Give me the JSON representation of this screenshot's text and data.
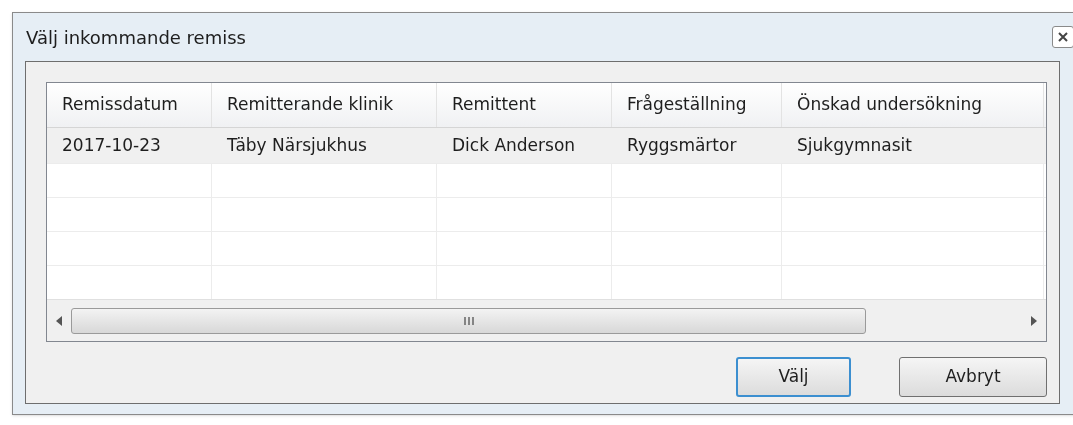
{
  "window": {
    "title": "Välj inkommande remiss"
  },
  "table": {
    "columns": [
      "Remissdatum",
      "Remitterande klinik",
      "Remittent",
      "Frågeställning",
      "Önskad undersökning"
    ],
    "rows": [
      {
        "cells": [
          "2017-10-23",
          "Täby Närsjukhus",
          "Dick Anderson",
          "Ryggsmärtor",
          "Sjukgymnasit"
        ],
        "selected": true
      }
    ]
  },
  "buttons": [
    {
      "label": "Välj",
      "default": true
    },
    {
      "label": "Avbryt",
      "default": false
    }
  ]
}
